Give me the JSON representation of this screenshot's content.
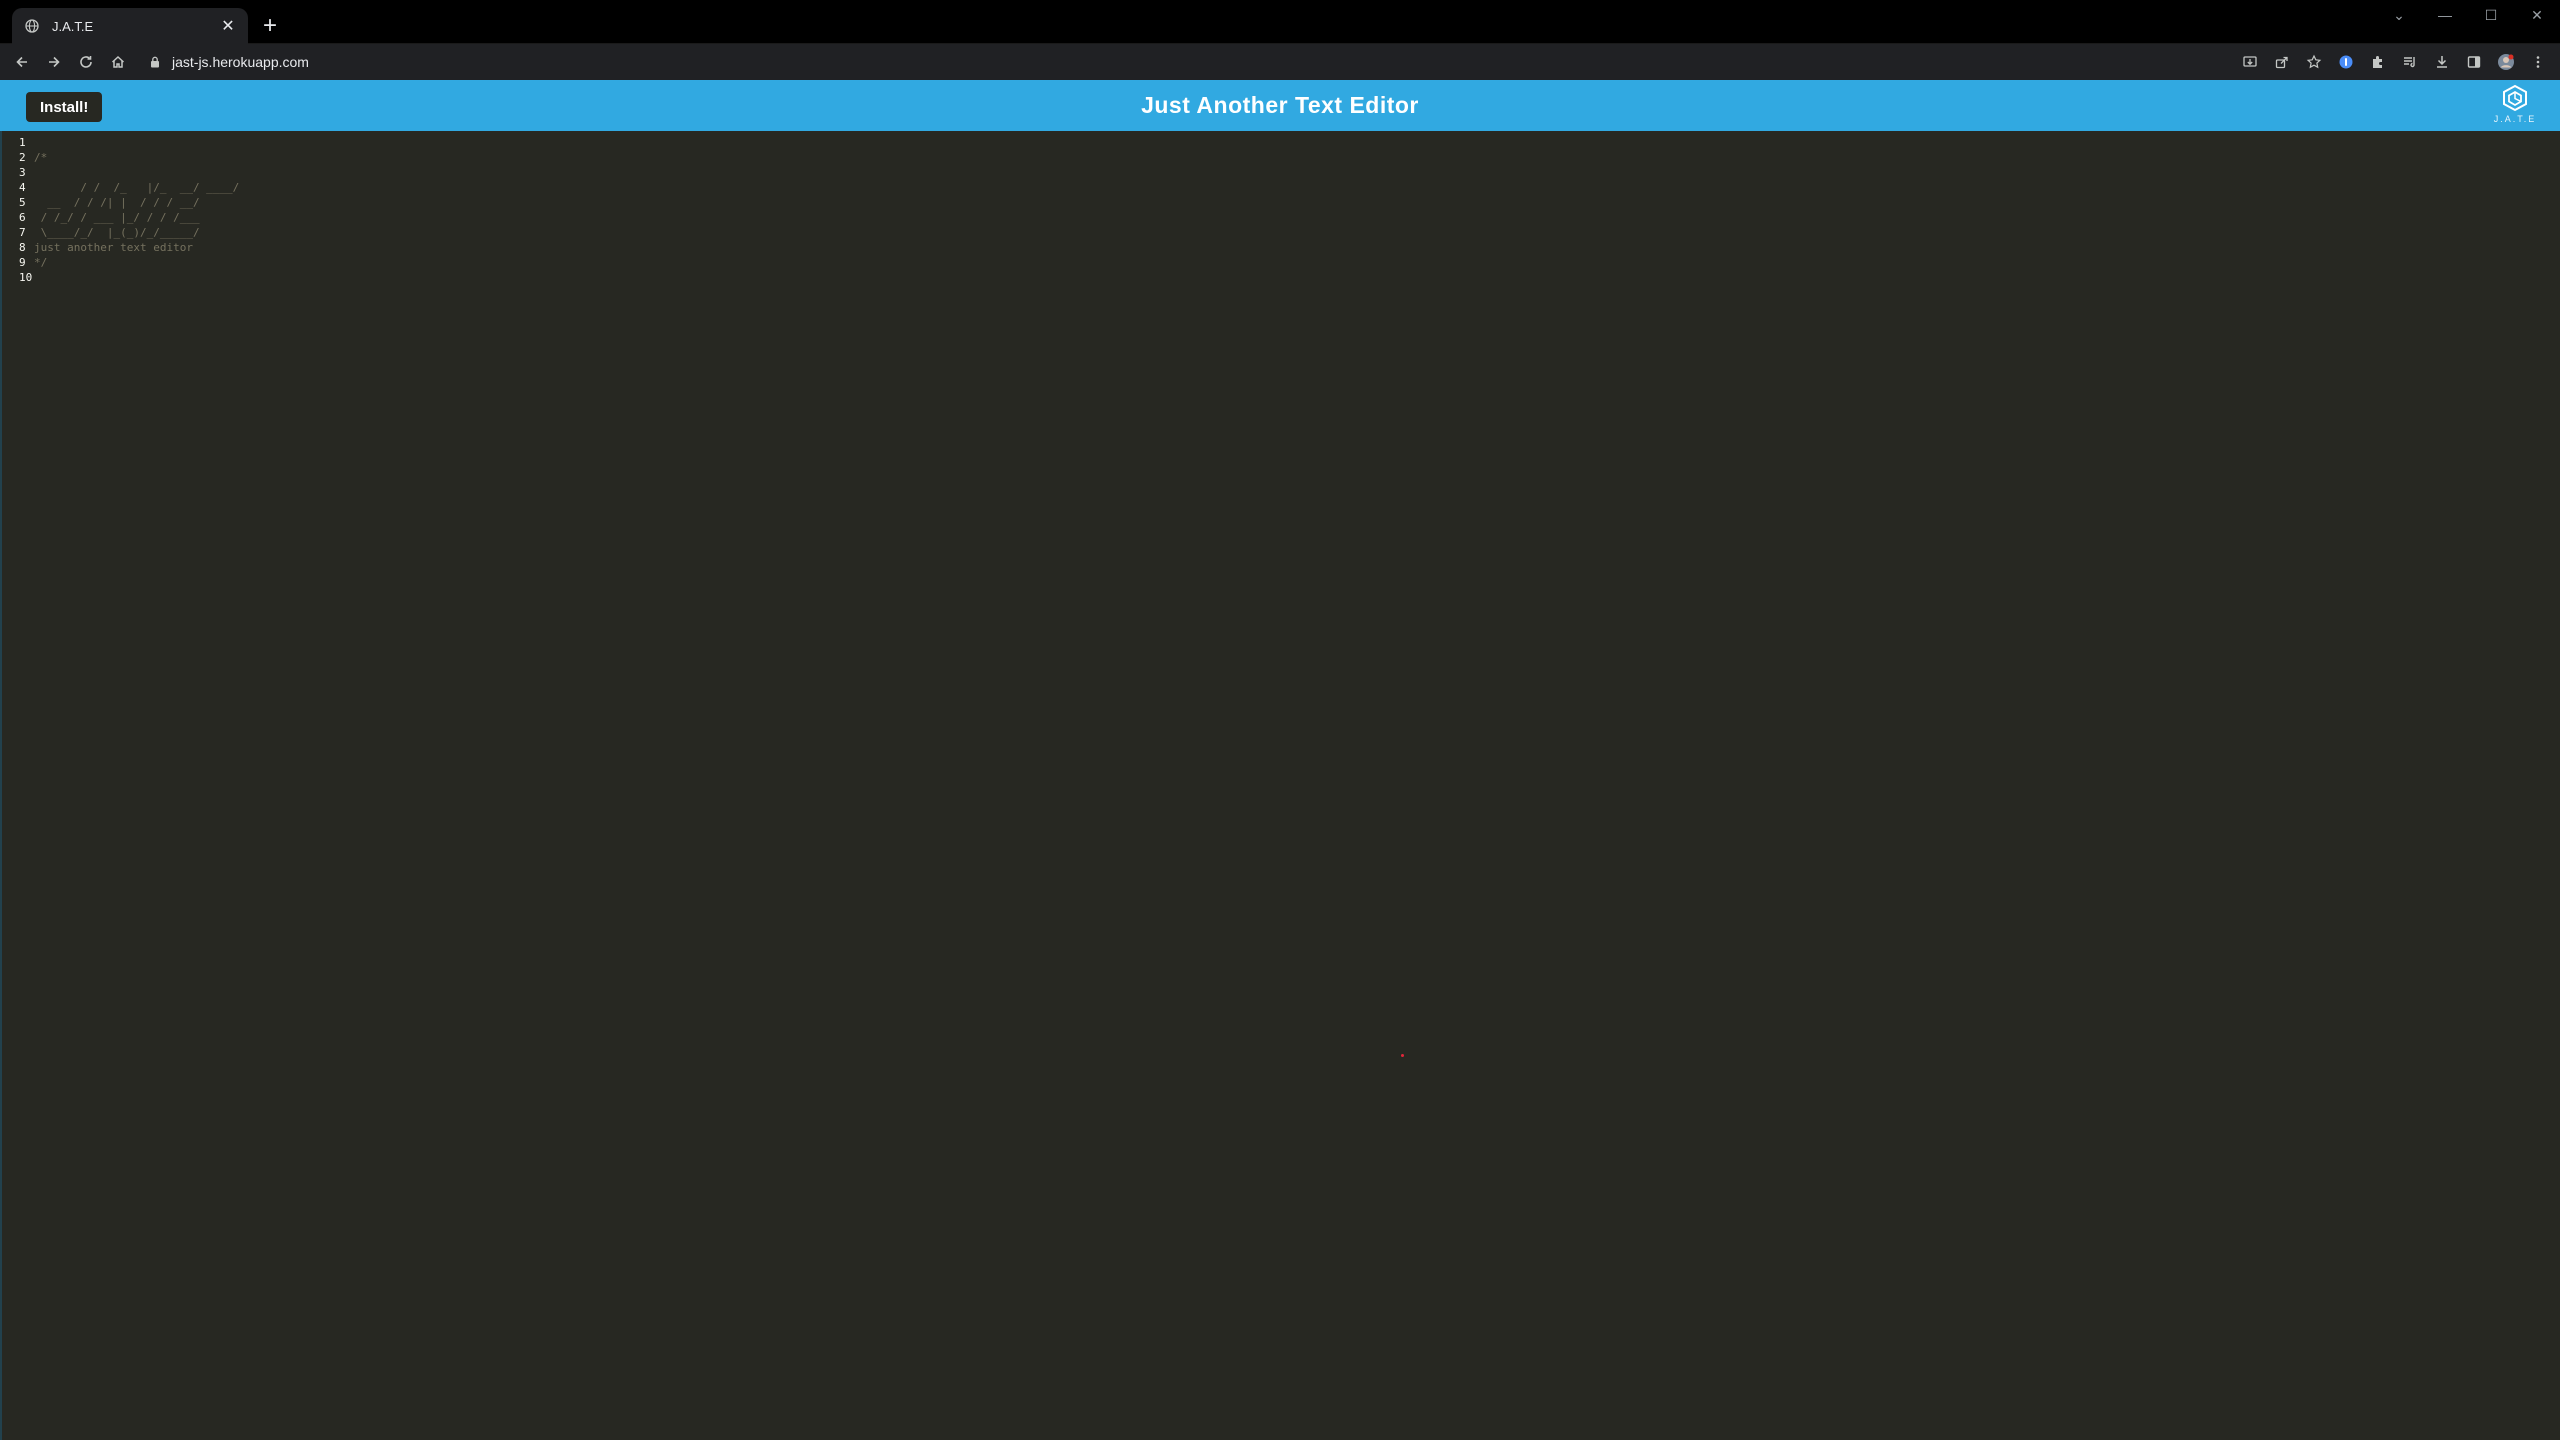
{
  "browser": {
    "tab_title": "J.A.T.E",
    "url": "jast-js.herokuapp.com"
  },
  "header": {
    "install_label": "Install!",
    "title": "Just Another Text Editor",
    "logo_text": "J.A.T.E"
  },
  "editor": {
    "line_numbers": [
      "1",
      "2",
      "3",
      "4",
      "5",
      "6",
      "7",
      "8",
      "9",
      "10"
    ],
    "lines": [
      "",
      "/*",
      "",
      "       / /  /_   |/_  __/ ____/",
      "  __  / / /| |  / / / __/",
      " / /_/ / ___ |_/ / / /___",
      " \\____/_/  |_(_)/_/_____/",
      "just another text editor",
      "*/",
      ""
    ]
  },
  "colors": {
    "header_bg": "#31a9e1",
    "editor_bg": "#272822",
    "comment": "#75715e"
  }
}
